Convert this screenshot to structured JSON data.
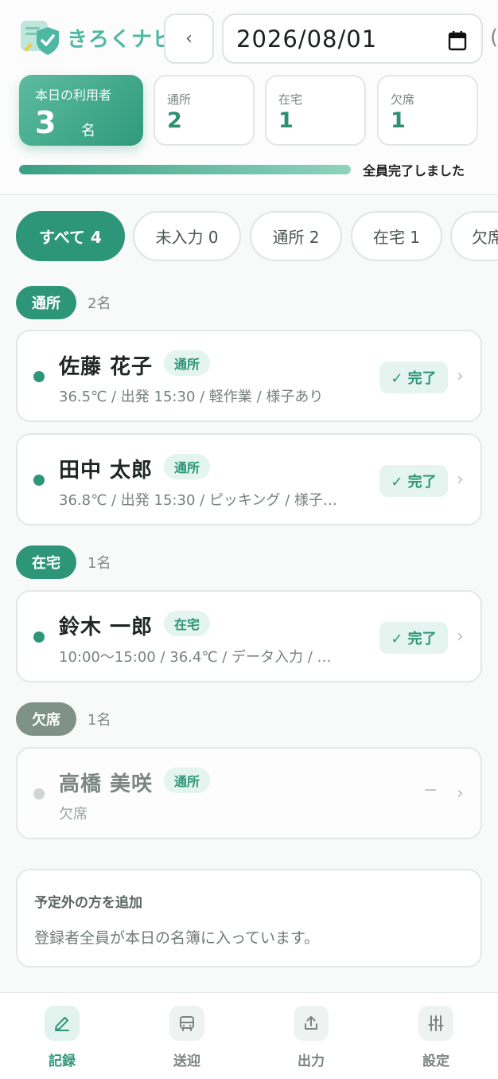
{
  "app": {
    "logo_text": "きろくナビ",
    "colors": {
      "accent": "#2e9678",
      "accent_light": "#e4f4ee",
      "absent": "#7f928a"
    }
  },
  "header": {
    "prev_icon": "chevron-left-icon",
    "date_value": "2026/08/01",
    "date_icon": "calendar-icon",
    "edge_glyph": "("
  },
  "stats": {
    "main": {
      "label": "本日の利用者",
      "value": "3",
      "unit": "名"
    },
    "commute": {
      "label": "通所",
      "value": "2"
    },
    "home": {
      "label": "在宅",
      "value": "1"
    },
    "absent": {
      "label": "欠席",
      "value": "1"
    }
  },
  "progress": {
    "percent": 100,
    "text": "全員完了しました"
  },
  "filters": [
    {
      "label": "すべて 4"
    },
    {
      "label": "未入力 0"
    },
    {
      "label": "通所 2"
    },
    {
      "label": "在宅 1"
    },
    {
      "label": "欠席"
    }
  ],
  "groups": [
    {
      "label": "通所",
      "count": "2名"
    },
    {
      "label": "在宅",
      "count": "1名"
    },
    {
      "label": "欠席",
      "count": "1名"
    }
  ],
  "cards": [
    {
      "name": "佐藤 花子",
      "tag": "通所",
      "detail": "36.5℃ / 出発 15:30 / 軽作業 / 様子あり",
      "status": "✓ 完了"
    },
    {
      "name": "田中 太郎",
      "tag": "通所",
      "detail": "36.8℃ / 出発 15:30 / ピッキング / 様子…",
      "status": "✓ 完了"
    },
    {
      "name": "鈴木 一郎",
      "tag": "在宅",
      "detail": "10:00〜15:00 / 36.4℃ / データ入力 / …",
      "status": "✓ 完了"
    },
    {
      "name": "高橋 美咲",
      "tag": "通所",
      "detail": "欠席",
      "status": "−"
    }
  ],
  "add_box": {
    "title": "予定外の方を追加",
    "message": "登録者全員が本日の名簿に入っています。"
  },
  "nav": [
    {
      "label": "記録",
      "icon": "pencil-icon"
    },
    {
      "label": "送迎",
      "icon": "bus-icon"
    },
    {
      "label": "出力",
      "icon": "upload-icon"
    },
    {
      "label": "設定",
      "icon": "sliders-icon"
    }
  ]
}
